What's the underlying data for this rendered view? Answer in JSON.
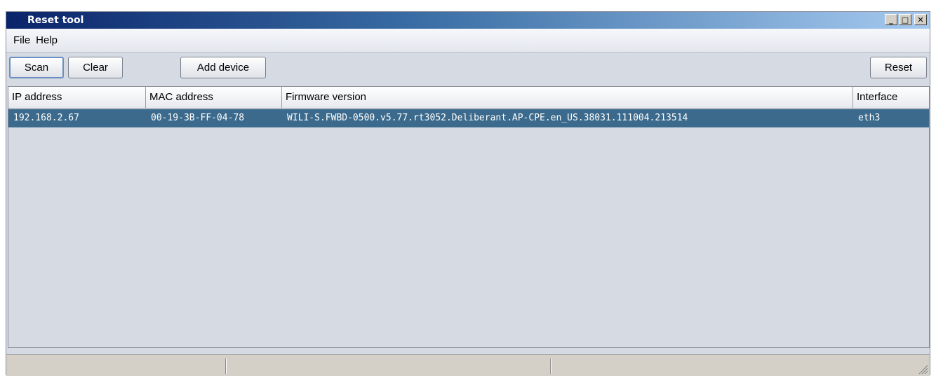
{
  "window": {
    "title": "Reset tool"
  },
  "title_buttons": {
    "minimize": "_",
    "maximize": "□",
    "close": "✕"
  },
  "menu": {
    "items": [
      "File",
      "Help"
    ]
  },
  "toolbar": {
    "scan_label": "Scan",
    "clear_label": "Clear",
    "add_device_label": "Add device",
    "reset_label": "Reset"
  },
  "table": {
    "columns": [
      "IP address",
      "MAC address",
      "Firmware version",
      "Interface"
    ],
    "rows": [
      [
        "192.168.2.67",
        "00-19-3B-FF-04-78",
        "WILI-S.FWBD-0500.v5.77.rt3052.Deliberant.AP-CPE.en_US.38031.111004.213514",
        "eth3"
      ]
    ]
  },
  "colors": {
    "selection": "#3b6a8c",
    "title_gradient_start": "#0a246a",
    "title_gradient_end": "#a6caf0"
  }
}
